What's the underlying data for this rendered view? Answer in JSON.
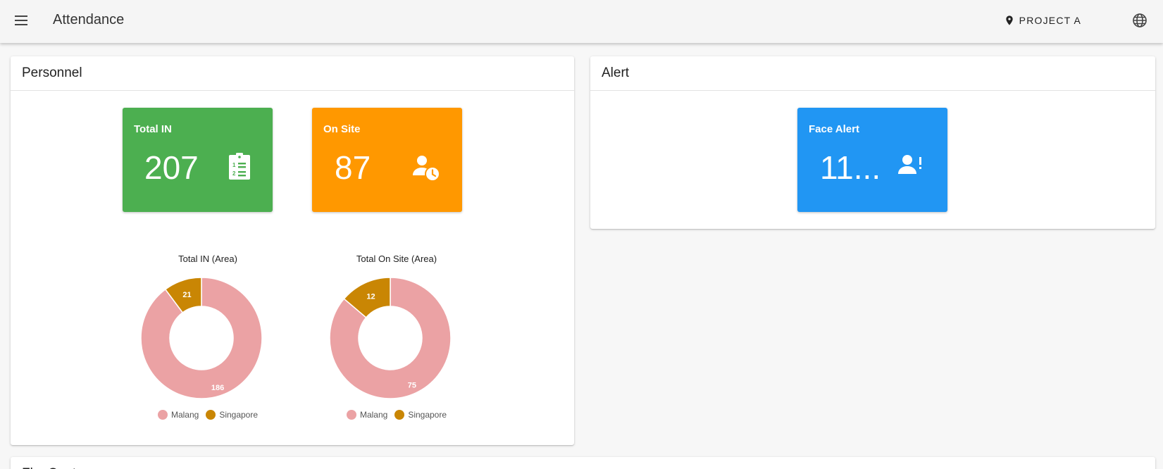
{
  "header": {
    "title": "Attendance",
    "menu_icon": "menu-icon",
    "project_label": "PROJECT A",
    "project_icon": "location-pin-icon",
    "language_icon": "globe-icon"
  },
  "personnel": {
    "title": "Personnel",
    "tiles": [
      {
        "label": "Total IN",
        "value": "207",
        "icon": "clipboard-list-icon",
        "color": "#4caf50"
      },
      {
        "label": "On Site",
        "value": "87",
        "icon": "person-clock-icon",
        "color": "#ff9800"
      }
    ]
  },
  "alert": {
    "title": "Alert",
    "tiles": [
      {
        "label": "Face Alert",
        "value": "11...",
        "icon": "person-alert-icon",
        "color": "#2196f3"
      }
    ]
  },
  "next_section": {
    "title": "Fl... C... t"
  },
  "chart_data": [
    {
      "type": "pie",
      "donut": true,
      "title": "Total IN (Area)",
      "categories": [
        "Malang",
        "Singapore"
      ],
      "values": [
        186,
        21
      ],
      "colors": [
        "#eba2a4",
        "#c98604"
      ],
      "legend": "bottom"
    },
    {
      "type": "pie",
      "donut": true,
      "title": "Total On Site (Area)",
      "categories": [
        "Malang",
        "Singapore"
      ],
      "values": [
        75,
        12
      ],
      "colors": [
        "#eba2a4",
        "#c98604"
      ],
      "legend": "bottom"
    }
  ]
}
